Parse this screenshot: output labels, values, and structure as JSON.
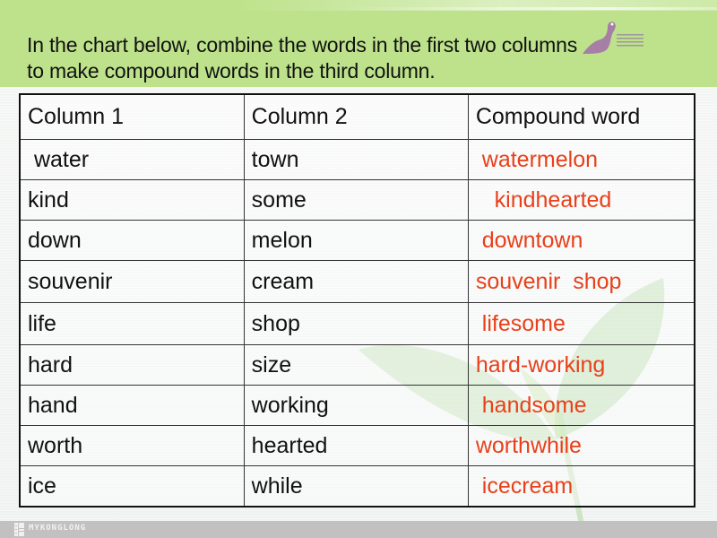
{
  "slide": {
    "instruction_lines": [
      "In the chart below, combine the words in the first two  columns",
      "to make compound words in the third column."
    ],
    "colors": {
      "header_band": "#bde28b",
      "answer_text": "#e8401a",
      "body_text": "#111111",
      "footer_bar": "#c1c1c1",
      "logo_mark": "#a77fa6"
    }
  },
  "table": {
    "headers": [
      "Column 1",
      "Column 2",
      "Compound word"
    ],
    "rows": [
      {
        "col1": " water",
        "col2": "town",
        "compound": " watermelon"
      },
      {
        "col1": "kind",
        "col2": "some",
        "compound": "   kindhearted"
      },
      {
        "col1": "down",
        "col2": "melon",
        "compound": " downtown"
      },
      {
        "col1": "souvenir",
        "col2": "cream",
        "compound": "souvenir  shop"
      },
      {
        "col1": "life",
        "col2": "shop",
        "compound": " lifesome"
      },
      {
        "col1": "hard",
        "col2": "size",
        "compound": "hard-working"
      },
      {
        "col1": "hand",
        "col2": "working",
        "compound": " handsome"
      },
      {
        "col1": "worth",
        "col2": "hearted",
        "compound": "worthwhile"
      },
      {
        "col1": "ice",
        "col2": "while",
        "compound": " icecream"
      }
    ]
  },
  "footer": {
    "brand": "MYKONGLONG",
    "icon": "brand-logo-icon"
  }
}
